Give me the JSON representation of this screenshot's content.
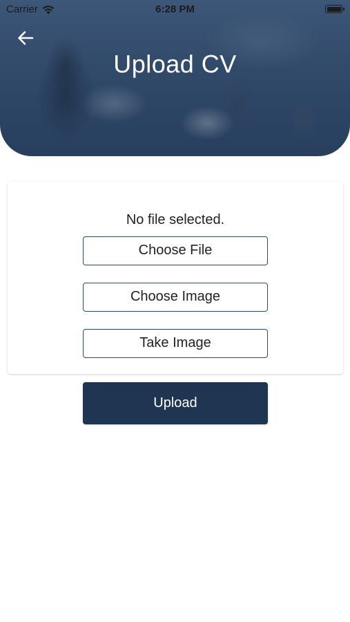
{
  "status_bar": {
    "carrier": "Carrier",
    "time": "6:28 PM",
    "wifi_icon": "wifi-icon",
    "battery_icon": "battery-icon"
  },
  "header": {
    "back_icon": "arrow-left-icon",
    "title": "Upload CV"
  },
  "card": {
    "file_status": "No file selected.",
    "choose_file_label": "Choose File",
    "choose_image_label": "Choose Image",
    "take_image_label": "Take Image"
  },
  "upload_label": "Upload",
  "colors": {
    "primary": "#1f3551",
    "outline": "#2d4866",
    "text": "#222222"
  }
}
